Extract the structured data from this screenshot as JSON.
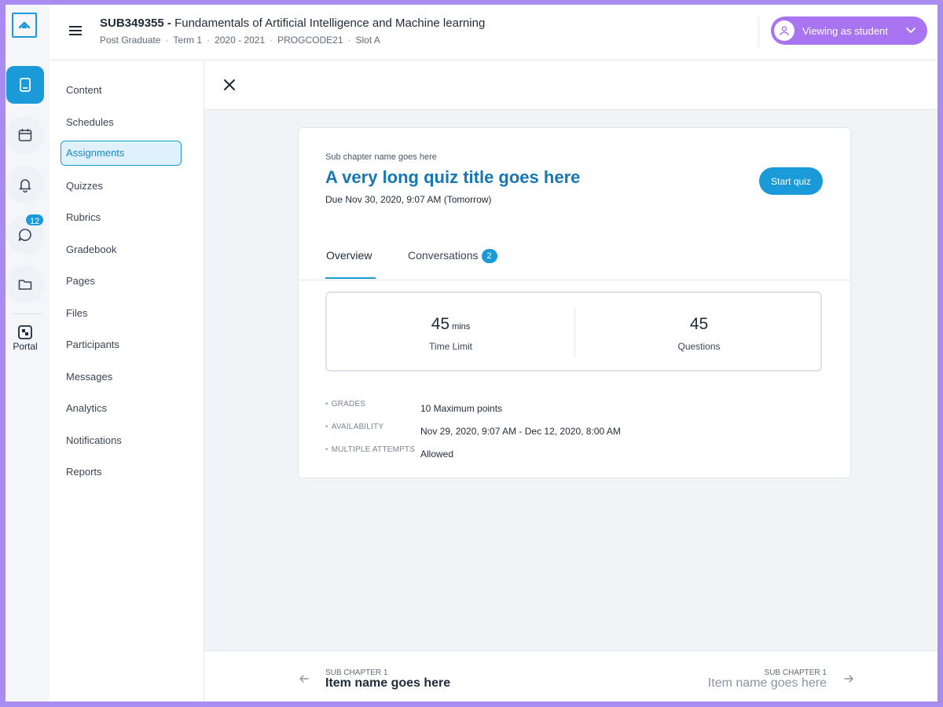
{
  "header": {
    "course_code": "SUB349355 -",
    "course_name": "Fundamentals of Artificial Intelligence and Machine learning",
    "meta": [
      "Post Graduate",
      "Term 1",
      "2020 - 2021",
      "PROGCODE21",
      "Slot A"
    ],
    "viewing_label": "Viewing as student"
  },
  "rail": {
    "messages_badge": "12",
    "portal_label": "Portal"
  },
  "sidenav": {
    "items": [
      "Content",
      "Schedules",
      "Assignments",
      "Quizzes",
      "Rubrics",
      "Gradebook",
      "Pages",
      "Files",
      "Participants",
      "Messages",
      "Analytics",
      "Notifications",
      "Reports"
    ],
    "active": "Assignments"
  },
  "quiz": {
    "sub_chapter": "Sub chapter name goes here",
    "title": "A very long quiz title goes here",
    "due": "Due Nov 30, 2020, 9:07 AM (Tomorrow)",
    "start_label": "Start quiz",
    "tabs": {
      "overview": "Overview",
      "conversations": "Conversations",
      "conversations_count": "2"
    },
    "stats": {
      "time_value": "45",
      "time_unit": "mins",
      "time_label": "Time Limit",
      "questions_value": "45",
      "questions_label": "Questions"
    },
    "details": [
      {
        "key": "GRADES",
        "value": "10 Maximum points"
      },
      {
        "key": "AVAILABILITY",
        "value": "Nov 29, 2020, 9:07 AM - Dec 12, 2020, 8:00 AM"
      },
      {
        "key": "MULTIPLE ATTEMPTS",
        "value": "Allowed"
      }
    ]
  },
  "pager": {
    "prev_small": "SUB CHAPTER 1",
    "prev_title": "Item name goes here",
    "next_small": "SUB CHAPTER 1",
    "next_title": "Item name goes here"
  },
  "colors": {
    "accent": "#1a9ad9",
    "title_blue": "#1578b4",
    "viewing_purple": "#a874f2",
    "frame_border": "#a98cf0"
  },
  "icons": [
    "logo-icon",
    "book-icon",
    "calendar-icon",
    "bell-icon",
    "chat-icon",
    "folder-icon",
    "portal-icon",
    "hamburger-icon",
    "user-icon",
    "chevron-down-icon",
    "close-icon",
    "arrow-left-icon",
    "arrow-right-icon"
  ]
}
